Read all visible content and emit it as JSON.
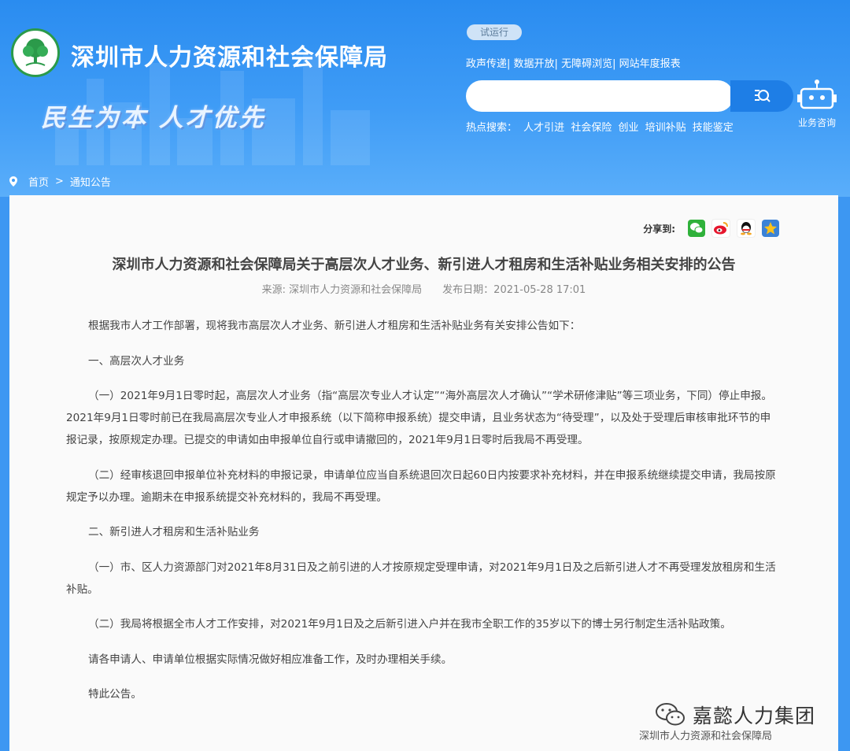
{
  "header": {
    "site_title": "深圳市人力资源和社会保障局",
    "slogan": "民生为本 人才优先",
    "trial_badge": "试运行",
    "top_links": [
      "政声传递",
      "数据开放",
      "无障碍浏览",
      "网站年度报表"
    ],
    "search": {
      "placeholder": "",
      "button_icon": "search-icon"
    },
    "hot_label": "热点搜索：",
    "hot_terms": [
      "人才引进",
      "社会保险",
      "创业",
      "培训补贴",
      "技能鉴定"
    ],
    "robot_label": "业务咨询"
  },
  "breadcrumb": {
    "home": "首页",
    "separator": ">",
    "current": "通知公告"
  },
  "share": {
    "label": "分享到:",
    "icons": [
      "wechat-icon",
      "weibo-icon",
      "qq-icon",
      "qzone-icon"
    ]
  },
  "article": {
    "title": "深圳市人力资源和社会保障局关于高层次人才业务、新引进人才租房和生活补贴业务相关安排的公告",
    "source": "来源: 深圳市人力资源和社会保障局",
    "date": "发布日期：2021-05-28 17:01",
    "paragraphs": [
      "根据我市人才工作部署，现将我市高层次人才业务、新引进人才租房和生活补贴业务有关安排公告如下：",
      "一、高层次人才业务",
      "（一）2021年9月1日零时起，高层次人才业务（指“高层次专业人才认定”“海外高层次人才确认”“学术研修津贴”等三项业务，下同）停止申报。2021年9月1日零时前已在我局高层次专业人才申报系统（以下简称申报系统）提交申请，且业务状态为“待受理”，以及处于受理后审核审批环节的申报记录，按原规定办理。已提交的申请如由申报单位自行或申请撤回的，2021年9月1日零时后我局不再受理。",
      "（二）经审核退回申报单位补充材料的申报记录，申请单位应当自系统退回次日起60日内按要求补充材料，并在申报系统继续提交申请，我局按原规定予以办理。逾期未在申报系统提交补充材料的，我局不再受理。",
      "二、新引进人才租房和生活补贴业务",
      "（一）市、区人力资源部门对2021年8月31日及之前引进的人才按原规定受理申请，对2021年9月1日及之后新引进人才不再受理发放租房和生活补贴。",
      "（二）我局将根据全市人才工作安排，对2021年9月1日及之后新引进入户并在我市全职工作的35岁以下的博士另行制定生活补贴政策。",
      "请各申请人、申请单位根据实际情况做好相应准备工作，及时办理相关手续。",
      "特此公告。"
    ]
  },
  "watermark": {
    "main": "嘉懿人力集团",
    "sub": "深圳市人力资源和社会保障局"
  },
  "colors": {
    "header_blue": "#2a8cf0",
    "search_button": "#1e7ee6",
    "logo_green": "#2b9a4a"
  }
}
